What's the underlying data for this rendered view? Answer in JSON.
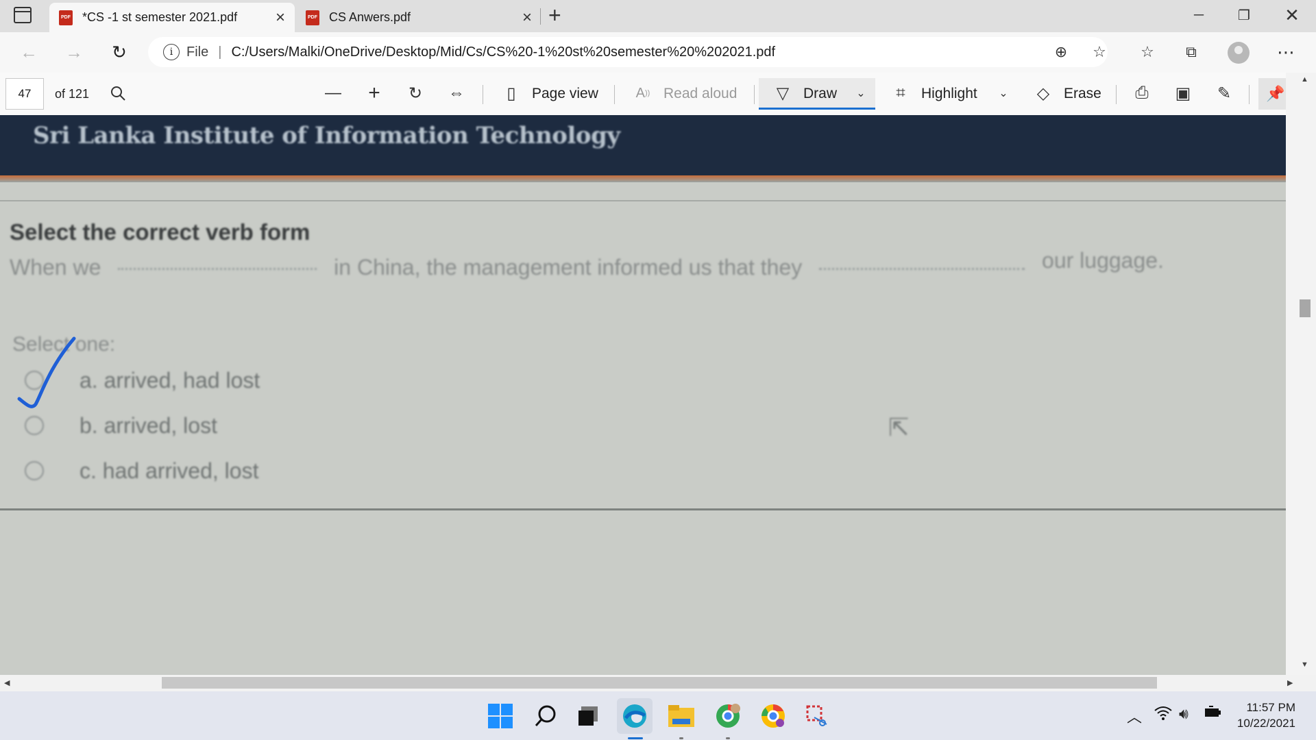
{
  "browser": {
    "tabs": [
      {
        "title": "*CS -1 st semester 2021.pdf",
        "icon": "pdf-icon",
        "active": true
      },
      {
        "title": "CS Anwers.pdf",
        "icon": "pdf-icon",
        "active": false
      }
    ],
    "address": {
      "scheme_label": "File",
      "url": "C:/Users/Malki/OneDrive/Desktop/Mid/Cs/CS%20-1%20st%20semester%20%202021.pdf"
    }
  },
  "pdf_toolbar": {
    "page_number": "47",
    "page_total": "of 121",
    "page_view_label": "Page view",
    "read_aloud_label": "Read aloud",
    "draw_label": "Draw",
    "highlight_label": "Highlight",
    "erase_label": "Erase",
    "accent_color": "#1a6fd0"
  },
  "document": {
    "institute": "Sri Lanka Institute of Information Technology",
    "question_title": "Select the correct verb form",
    "question_part1": "When we",
    "question_part2": "in China, the management informed us that they",
    "question_part3": "our luggage.",
    "select_label": "Select one:",
    "options": [
      {
        "label": "a. arrived, had lost"
      },
      {
        "label": "b. arrived, lost"
      },
      {
        "label": "c. had arrived, lost"
      }
    ],
    "ink_color": "#1f5fd6"
  },
  "taskbar": {
    "time": "11:57 PM",
    "date": "10/22/2021"
  }
}
